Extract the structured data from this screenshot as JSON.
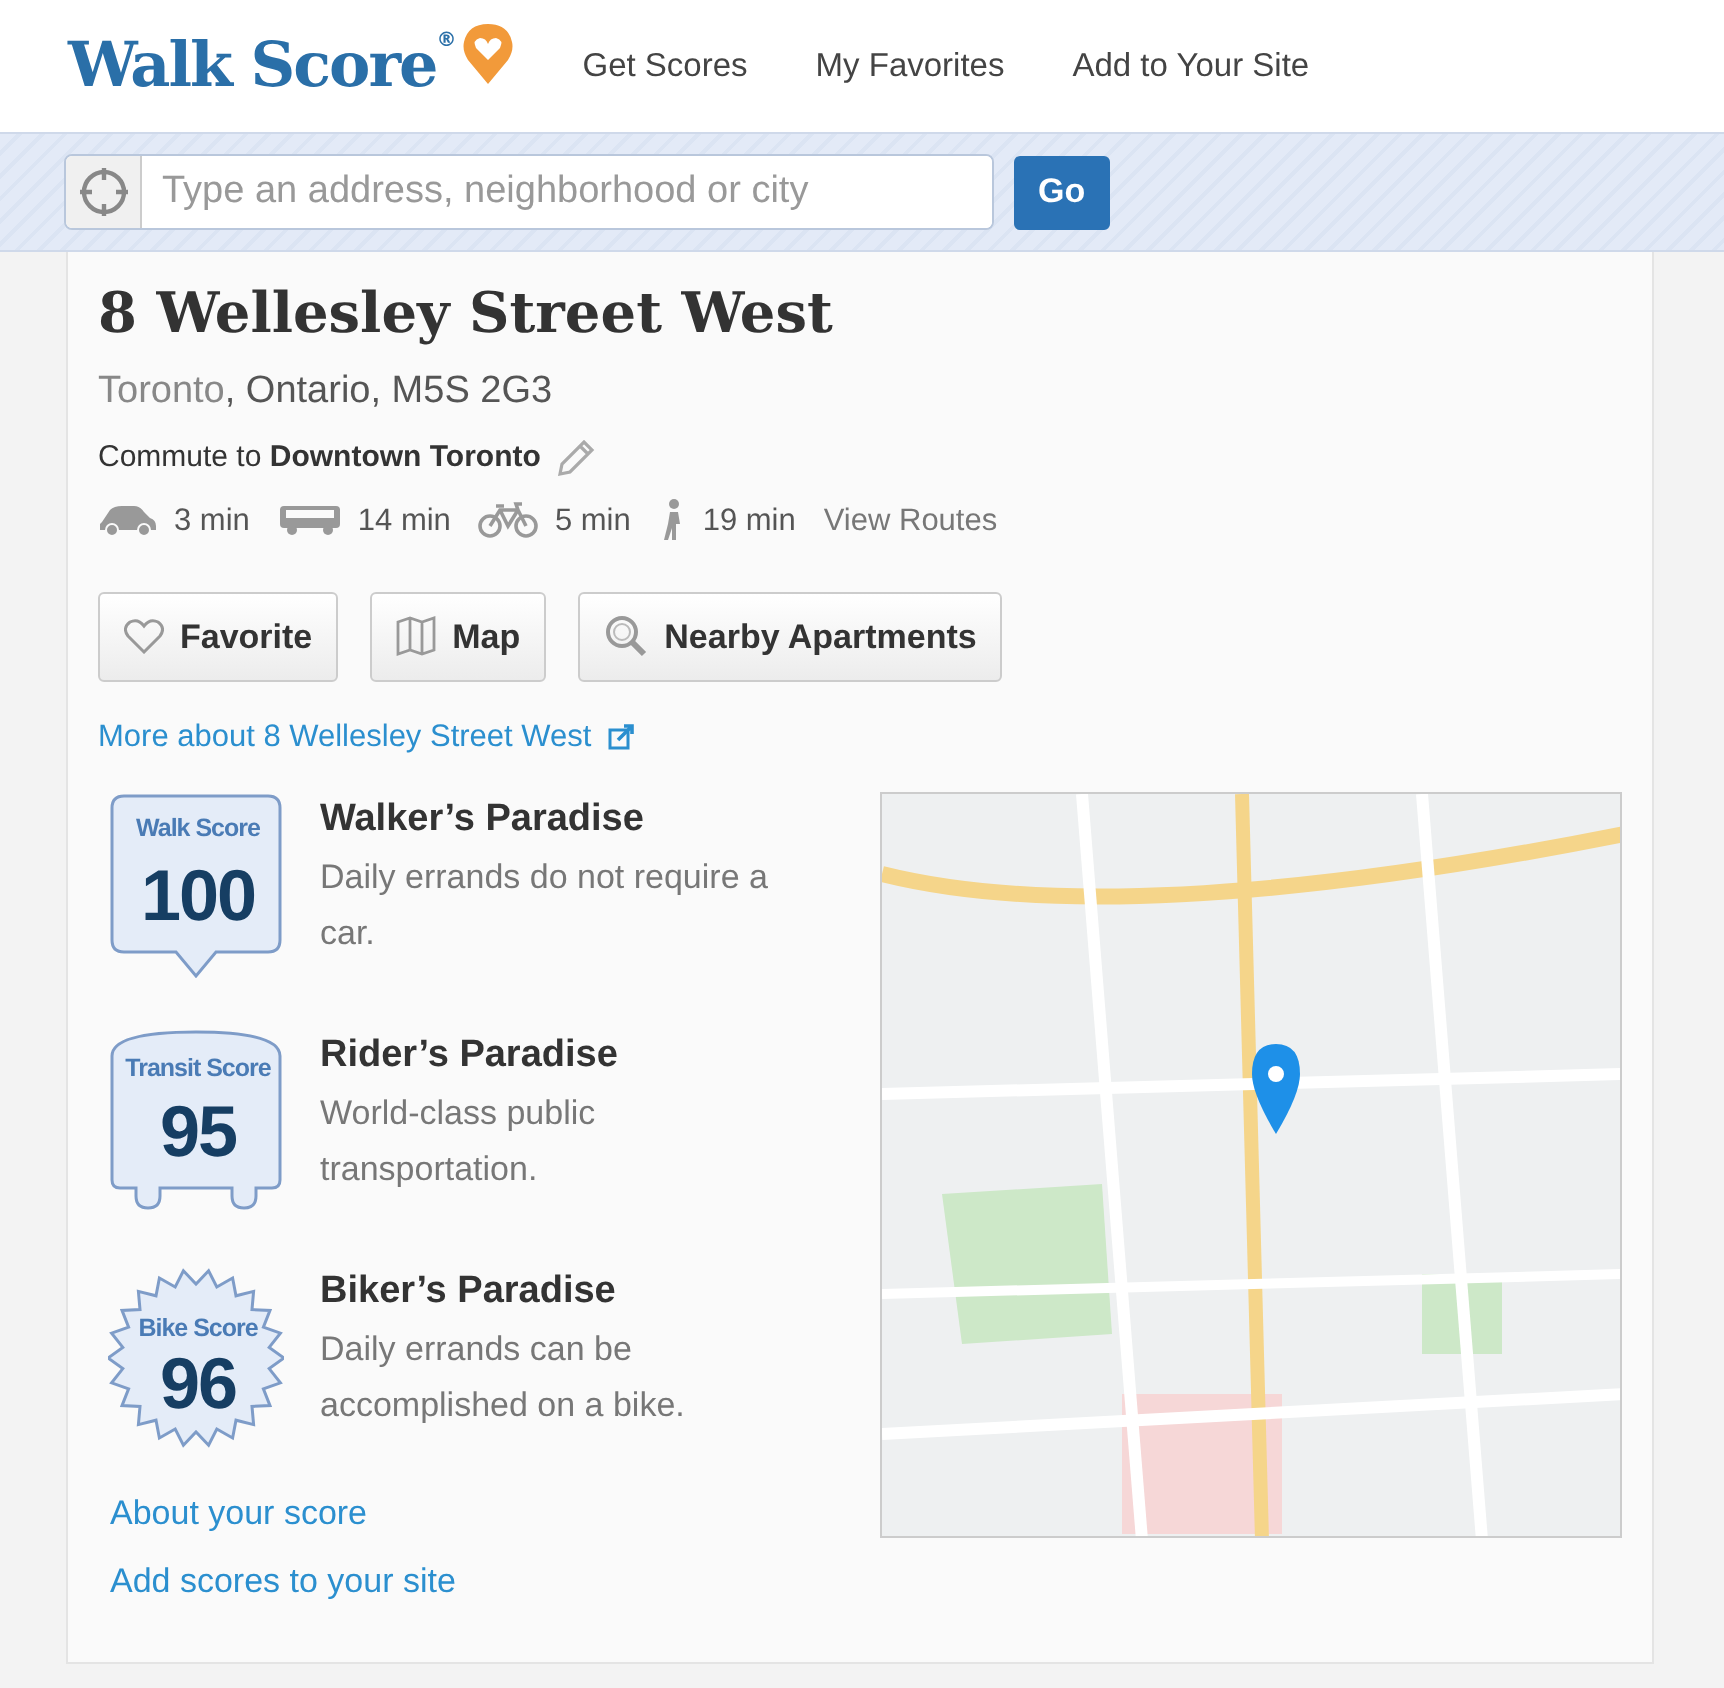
{
  "header": {
    "logo": "Walk Score",
    "logo_mark": "®",
    "nav": [
      "Get Scores",
      "My Favorites",
      "Add to Your Site"
    ]
  },
  "search": {
    "placeholder": "Type an address, neighborhood or city",
    "button": "Go"
  },
  "address": {
    "title": "8 Wellesley Street West",
    "city": "Toronto",
    "rest": ", Ontario, M5S 2G3"
  },
  "commute": {
    "prefix": "Commute to",
    "destination": "Downtown Toronto"
  },
  "modes": [
    {
      "kind": "car",
      "time": "3 min"
    },
    {
      "kind": "bus",
      "time": "14 min"
    },
    {
      "kind": "bike",
      "time": "5 min"
    },
    {
      "kind": "walk",
      "time": "19 min"
    }
  ],
  "view_routes": "View Routes",
  "buttons": [
    {
      "kind": "heart",
      "label": "Favorite"
    },
    {
      "kind": "map",
      "label": "Map"
    },
    {
      "kind": "search",
      "label": "Nearby Apartments"
    }
  ],
  "more_link": "More about 8 Wellesley Street West",
  "scores": [
    {
      "kind": "walk",
      "label": "Walk Score",
      "value": "100",
      "title": "Walker’s Paradise",
      "description": "Daily errands do not require a car."
    },
    {
      "kind": "transit",
      "label": "Transit Score",
      "value": "95",
      "title": "Rider’s Paradise",
      "description": "World-class public transportation."
    },
    {
      "kind": "bike",
      "label": "Bike Score",
      "value": "96",
      "title": "Biker’s Paradise",
      "description": "Daily errands can be accomplished on a bike."
    }
  ],
  "links": [
    "About your score",
    "Add scores to your site"
  ],
  "map": {
    "kind": "picture"
  }
}
